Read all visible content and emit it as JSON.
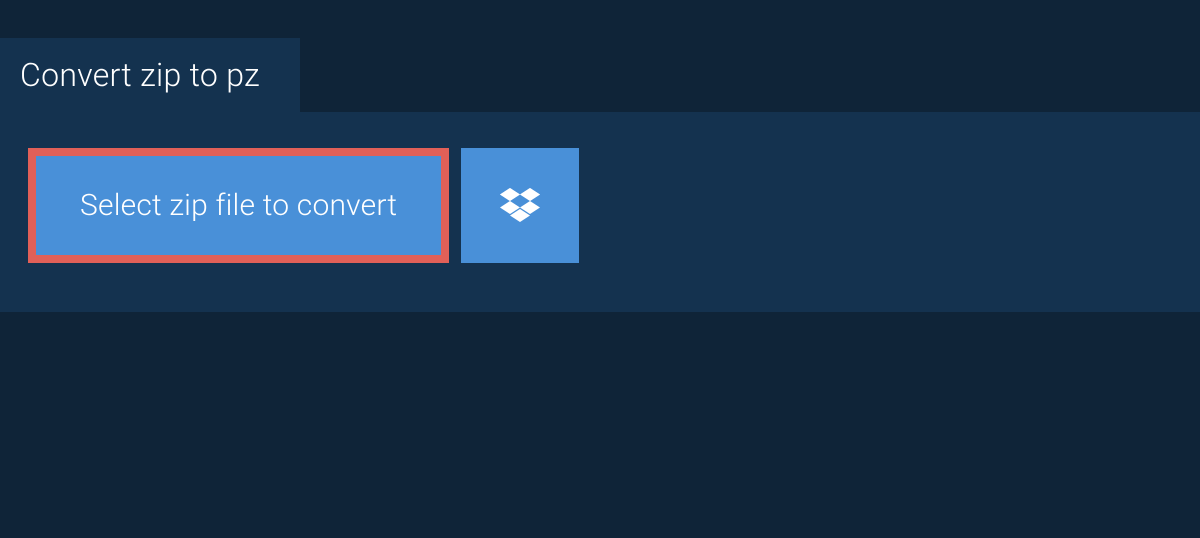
{
  "tab": {
    "label": "Convert zip to pz"
  },
  "main": {
    "select_button_label": "Select zip file to convert"
  },
  "colors": {
    "bg": "#0f2438",
    "panel": "#14324f",
    "button": "#4990d8",
    "highlight_border": "#e16058",
    "text": "#ffffff"
  }
}
